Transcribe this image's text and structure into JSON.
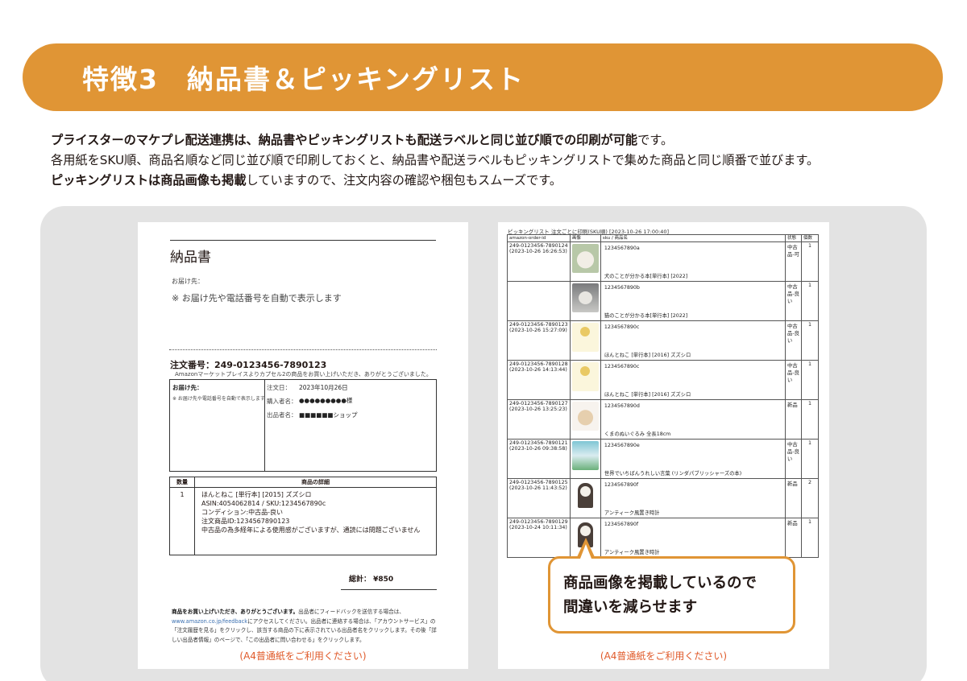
{
  "banner": {
    "title": "特徴3　納品書＆ピッキングリスト"
  },
  "intro": {
    "l1_bold": "プライスターのマケプレ配送連携は、納品書やピッキングリストも配送ラベルと同じ並び順での印刷が可能",
    "l1_rest": "です。",
    "l2": "各用紙をSKU順、商品名順など同じ並び順で印刷しておくと、納品書や配送ラベルもピッキングリストで集めた商品と同じ順番で並びます。",
    "l3_bold": "ピッキングリストは商品画像も掲載",
    "l3_rest": "していますので、注文内容の確認や梱包もスムーズです。"
  },
  "invoice": {
    "title": "納品書",
    "deliver_to_label": "お届け先：",
    "auto_note": "※ お届け先や電話番号を自動で表示します",
    "order_number": "注文番号：249-0123456-7890123",
    "thanks_line": "Amazonマーケットプレイスよりカプセル2の商品をお買い上げいただき、ありがとうございました。",
    "box_deliver_label": "お届け先：",
    "box_auto_note": "※ お届け先や電話番号を自動で表示します",
    "order_date_label": "注文日：",
    "order_date": "2023年10月26日",
    "buyer_label": "購入者名：",
    "buyer": "●●●●●●●●●様",
    "seller_label": "出品者名：",
    "seller": "■■■■■■ショップ",
    "qty_header": "数量",
    "detail_header": "商品の詳細",
    "qty": "1",
    "detail_lines": [
      "ほんとねこ [単行本] [2015] ズズシロ",
      "ASIN:4054062814 / SKU:1234567890c",
      "コンディション:中古品-良い",
      "注文商品ID:1234567890123",
      "中古品の為多経年による使用感がございますが、通読には問題ございません"
    ],
    "total": "総計：  ¥850",
    "footer_bold": "商品をお買い上げいただき、ありがとうございます。",
    "footer_1": "出品者にフィードバックを送信する場合は、",
    "footer_link": "www.amazon.co.jp/feedback",
    "footer_2": "にアクセスしてください。出品者に連絡する場合は、「アカウントサービス」の「注文履歴を見る」をクリックし、該当する商品の下に表示されている出品者名をクリックします。その後「詳しい出品者情報」のページで、「この出品者に問い合わせる」をクリックします。",
    "a4_note": "(A4普通紙をご利用ください)"
  },
  "picking": {
    "header": "ピッキングリスト 注文ごとに印刷(SKU順) [2023-10-26 17:00:40]",
    "columns": [
      "amazon-order-id",
      "画像",
      "sku / 商品名",
      "状態",
      "個数"
    ],
    "rows": [
      {
        "order": "249-0123456-7890124",
        "date": "(2023-10-26 16:26:53)",
        "sku": "1234567890a",
        "name": "犬のことが分かる本[単行本] [2022]",
        "cond": "中古品-可",
        "qty": "1",
        "thumb": "dog-photo-icon"
      },
      {
        "order": "",
        "date": "",
        "sku": "1234567890b",
        "name": "猫のことが分かる本[単行本] [2022]",
        "cond": "中古品-良い",
        "qty": "1",
        "thumb": "cat-photo-icon"
      },
      {
        "order": "249-0123456-7890123",
        "date": "(2023-10-26 15:27:09)",
        "sku": "1234567890c",
        "name": "ほんとねこ [単行本] [2016] ズズシロ",
        "cond": "中古品-良い",
        "qty": "1",
        "thumb": "book-cover-icon"
      },
      {
        "order": "249-0123456-7890128",
        "date": "(2023-10-26 14:13:44)",
        "sku": "1234567890c",
        "name": "ほんとねこ [単行本] [2016] ズズシロ",
        "cond": "中古品-良い",
        "qty": "1",
        "thumb": "book-cover-icon"
      },
      {
        "order": "249-0123456-7890127",
        "date": "(2023-10-26 13:25:23)",
        "sku": "1234567890d",
        "name": "くまのぬいぐるみ 全長18cm",
        "cond": "新品",
        "qty": "1",
        "thumb": "teddy-bear-icon"
      },
      {
        "order": "249-0123456-7890121",
        "date": "(2023-10-26 09:38:58)",
        "sku": "1234567890e",
        "name": "世界でいちばんうれしい言葉 (リンダパブリッシャーズの本)",
        "cond": "中古品-良い",
        "qty": "1",
        "thumb": "green-book-icon"
      },
      {
        "order": "249-0123456-7890125",
        "date": "(2023-10-26 11:43:52)",
        "sku": "1234567890f",
        "name": "アンティーク風置き時計",
        "cond": "新品",
        "qty": "2",
        "thumb": "clock-icon"
      },
      {
        "order": "249-0123456-7890129",
        "date": "(2023-10-24 10:11:34)",
        "sku": "1234567890f",
        "name": "アンティーク風置き時計",
        "cond": "新品",
        "qty": "1",
        "thumb": "clock-icon"
      }
    ],
    "a4_note": "(A4普通紙をご利用ください)"
  },
  "callout": {
    "line1": "商品画像を掲載しているので",
    "line2": "間違いを減らせます"
  },
  "colors": {
    "accent": "#E09535",
    "note": "#E05A2A",
    "panel": "#E3E3E3"
  }
}
